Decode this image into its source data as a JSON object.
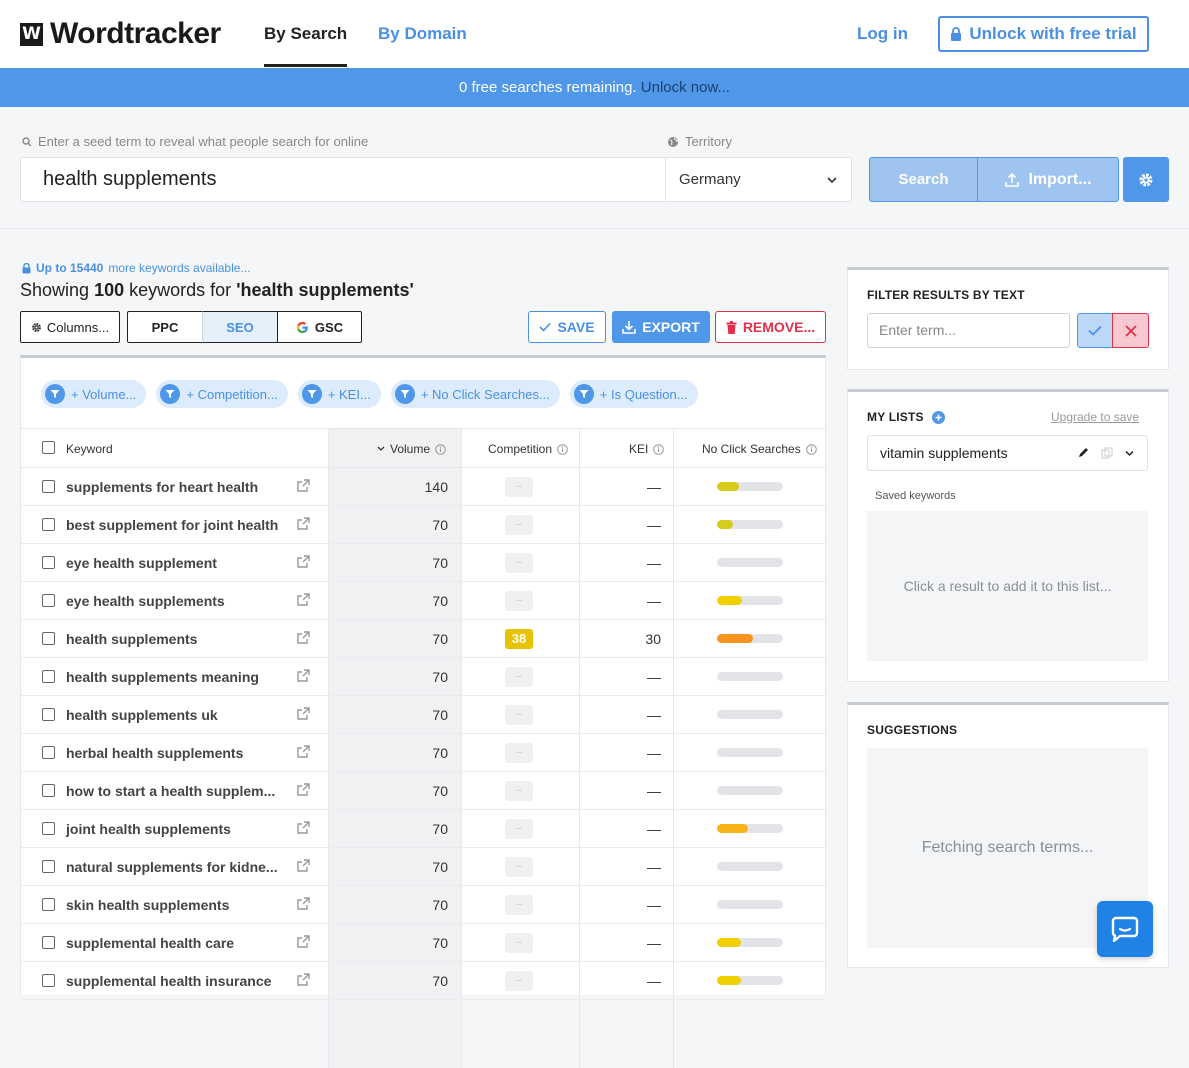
{
  "header": {
    "logo_mark": "W",
    "logo_text": "Wordtracker",
    "tabs": [
      {
        "label": "By Search",
        "active": true
      },
      {
        "label": "By Domain",
        "active": false
      }
    ],
    "login": "Log in",
    "trial_button": "Unlock with free trial"
  },
  "banner": {
    "text": "0 free searches remaining.",
    "link": "Unlock now..."
  },
  "search": {
    "seed_hint": "Enter a seed term to reveal what people search for online",
    "seed_value": "health supplements",
    "territory_hint": "Territory",
    "territory_value": "Germany",
    "search_button": "Search",
    "import_button": "Import..."
  },
  "results": {
    "more_prefix": "Up to 15440",
    "more_suffix": "more keywords available...",
    "showing_pre": "Showing",
    "showing_count": "100",
    "showing_mid": "keywords for",
    "showing_term": "'health supplements'",
    "columns_button": "Columns...",
    "segments": [
      "PPC",
      "SEO",
      "GSC"
    ],
    "save_button": "SAVE",
    "export_button": "EXPORT",
    "remove_button": "REMOVE..."
  },
  "filter_chips": [
    "+ Volume...",
    "+ Competition...",
    "+ KEI...",
    "+ No Click Searches...",
    "+ Is Question..."
  ],
  "table": {
    "headers": {
      "keyword": "Keyword",
      "volume": "Volume",
      "competition": "Competition",
      "kei": "KEI",
      "no_click": "No Click Searches"
    },
    "rows": [
      {
        "keyword": "supplements for heart health",
        "volume": "140",
        "competition": "–",
        "kei": "—",
        "no_click": 0.33,
        "bar_color": "#d7cc1c"
      },
      {
        "keyword": "best supplement for joint health",
        "volume": "70",
        "competition": "–",
        "kei": "—",
        "no_click": 0.24,
        "bar_color": "#d7cc1c"
      },
      {
        "keyword": "eye health supplement",
        "volume": "70",
        "competition": "–",
        "kei": "—",
        "no_click": 0,
        "bar_color": "#d7cc1c"
      },
      {
        "keyword": "eye health supplements",
        "volume": "70",
        "competition": "–",
        "kei": "—",
        "no_click": 0.38,
        "bar_color": "#f0d000"
      },
      {
        "keyword": "health supplements",
        "volume": "70",
        "competition": "38",
        "kei": "30",
        "no_click": 0.55,
        "bar_color": "#f7941d"
      },
      {
        "keyword": "health supplements meaning",
        "volume": "70",
        "competition": "–",
        "kei": "—",
        "no_click": 0,
        "bar_color": "#d7cc1c"
      },
      {
        "keyword": "health supplements uk",
        "volume": "70",
        "competition": "–",
        "kei": "—",
        "no_click": 0,
        "bar_color": "#d7cc1c"
      },
      {
        "keyword": "herbal health supplements",
        "volume": "70",
        "competition": "–",
        "kei": "—",
        "no_click": 0,
        "bar_color": "#d7cc1c"
      },
      {
        "keyword": "how to start a health supplem...",
        "volume": "70",
        "competition": "–",
        "kei": "—",
        "no_click": 0,
        "bar_color": "#d7cc1c"
      },
      {
        "keyword": "joint health supplements",
        "volume": "70",
        "competition": "–",
        "kei": "—",
        "no_click": 0.47,
        "bar_color": "#f7b318"
      },
      {
        "keyword": "natural supplements for kidne...",
        "volume": "70",
        "competition": "–",
        "kei": "—",
        "no_click": 0,
        "bar_color": "#d7cc1c"
      },
      {
        "keyword": "skin health supplements",
        "volume": "70",
        "competition": "–",
        "kei": "—",
        "no_click": 0,
        "bar_color": "#d7cc1c"
      },
      {
        "keyword": "supplemental health care",
        "volume": "70",
        "competition": "–",
        "kei": "—",
        "no_click": 0.36,
        "bar_color": "#f0d000"
      },
      {
        "keyword": "supplemental health insurance",
        "volume": "70",
        "competition": "–",
        "kei": "—",
        "no_click": 0.36,
        "bar_color": "#f0d000"
      }
    ]
  },
  "filter_panel": {
    "title": "FILTER RESULTS BY TEXT",
    "placeholder": "Enter term..."
  },
  "lists_panel": {
    "title": "MY LISTS",
    "upgrade": "Upgrade to save",
    "selected_list": "vitamin supplements",
    "saved_label": "Saved keywords",
    "empty_text": "Click a result to add it to this list..."
  },
  "suggestions_panel": {
    "title": "SUGGESTIONS",
    "loading_text": "Fetching search terms..."
  },
  "colors": {
    "accent": "#4f97e8",
    "danger": "#e0304a"
  }
}
